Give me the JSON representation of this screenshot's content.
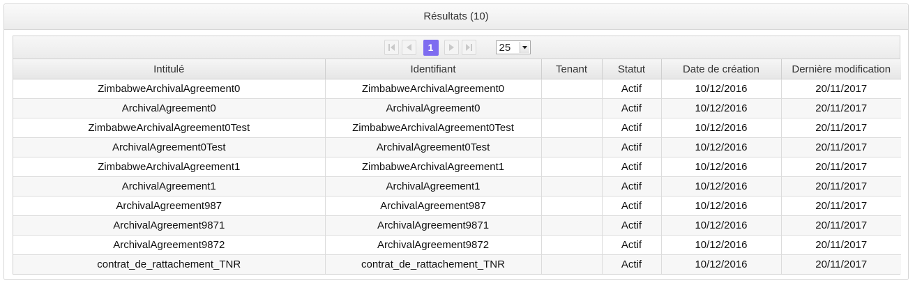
{
  "panel": {
    "title": "Résultats (10)"
  },
  "paginator": {
    "current_page": "1",
    "rows_per_page": "25"
  },
  "columns": [
    "Intitulé",
    "Identifiant",
    "Tenant",
    "Statut",
    "Date de création",
    "Dernière modification"
  ],
  "rows": [
    {
      "name": "ZimbabweArchivalAgreement0",
      "identifier": "ZimbabweArchivalAgreement0",
      "tenant": "",
      "status": "Actif",
      "created": "10/12/2016",
      "modified": "20/11/2017"
    },
    {
      "name": "ArchivalAgreement0",
      "identifier": "ArchivalAgreement0",
      "tenant": "",
      "status": "Actif",
      "created": "10/12/2016",
      "modified": "20/11/2017"
    },
    {
      "name": "ZimbabweArchivalAgreement0Test",
      "identifier": "ZimbabweArchivalAgreement0Test",
      "tenant": "",
      "status": "Actif",
      "created": "10/12/2016",
      "modified": "20/11/2017"
    },
    {
      "name": "ArchivalAgreement0Test",
      "identifier": "ArchivalAgreement0Test",
      "tenant": "",
      "status": "Actif",
      "created": "10/12/2016",
      "modified": "20/11/2017"
    },
    {
      "name": "ZimbabweArchivalAgreement1",
      "identifier": "ZimbabweArchivalAgreement1",
      "tenant": "",
      "status": "Actif",
      "created": "10/12/2016",
      "modified": "20/11/2017"
    },
    {
      "name": "ArchivalAgreement1",
      "identifier": "ArchivalAgreement1",
      "tenant": "",
      "status": "Actif",
      "created": "10/12/2016",
      "modified": "20/11/2017"
    },
    {
      "name": "ArchivalAgreement987",
      "identifier": "ArchivalAgreement987",
      "tenant": "",
      "status": "Actif",
      "created": "10/12/2016",
      "modified": "20/11/2017"
    },
    {
      "name": "ArchivalAgreement9871",
      "identifier": "ArchivalAgreement9871",
      "tenant": "",
      "status": "Actif",
      "created": "10/12/2016",
      "modified": "20/11/2017"
    },
    {
      "name": "ArchivalAgreement9872",
      "identifier": "ArchivalAgreement9872",
      "tenant": "",
      "status": "Actif",
      "created": "10/12/2016",
      "modified": "20/11/2017"
    },
    {
      "name": "contrat_de_rattachement_TNR",
      "identifier": "contrat_de_rattachement_TNR",
      "tenant": "",
      "status": "Actif",
      "created": "10/12/2016",
      "modified": "20/11/2017"
    }
  ],
  "colors": {
    "active_page": "#7e6cf0",
    "header_bg": "#ececec"
  }
}
